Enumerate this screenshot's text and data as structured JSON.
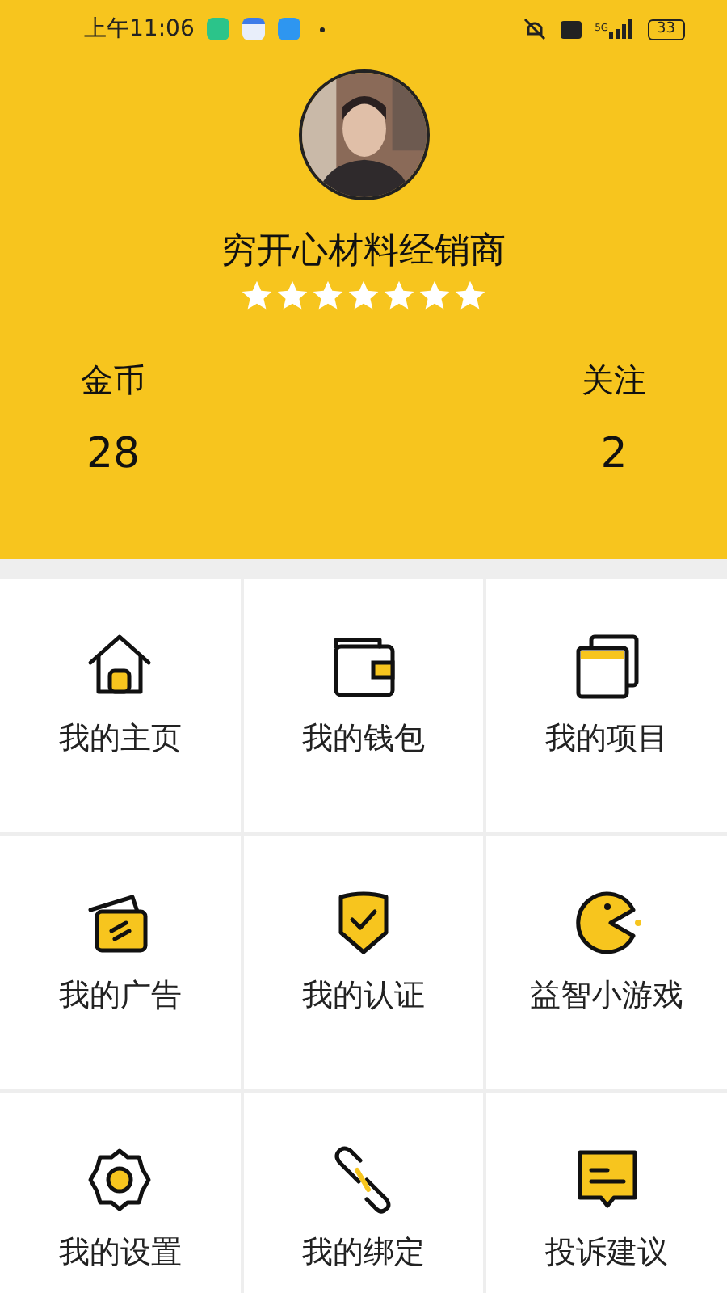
{
  "status_bar": {
    "time": "上午11:06",
    "network": "5G",
    "battery": "33"
  },
  "profile": {
    "name": "穷开心材料经销商",
    "stars": 7
  },
  "stats": [
    {
      "label": "金币",
      "value": "28"
    },
    {
      "label": "关注",
      "value": "2"
    }
  ],
  "menu": [
    {
      "kind": "home",
      "label": "我的主页"
    },
    {
      "kind": "wallet",
      "label": "我的钱包"
    },
    {
      "kind": "project",
      "label": "我的项目"
    },
    {
      "kind": "ad",
      "label": "我的广告"
    },
    {
      "kind": "verify",
      "label": "我的认证"
    },
    {
      "kind": "game",
      "label": "益智小游戏"
    },
    {
      "kind": "settings",
      "label": "我的设置"
    },
    {
      "kind": "link",
      "label": "我的绑定"
    },
    {
      "kind": "feedback",
      "label": "投诉建议"
    }
  ]
}
